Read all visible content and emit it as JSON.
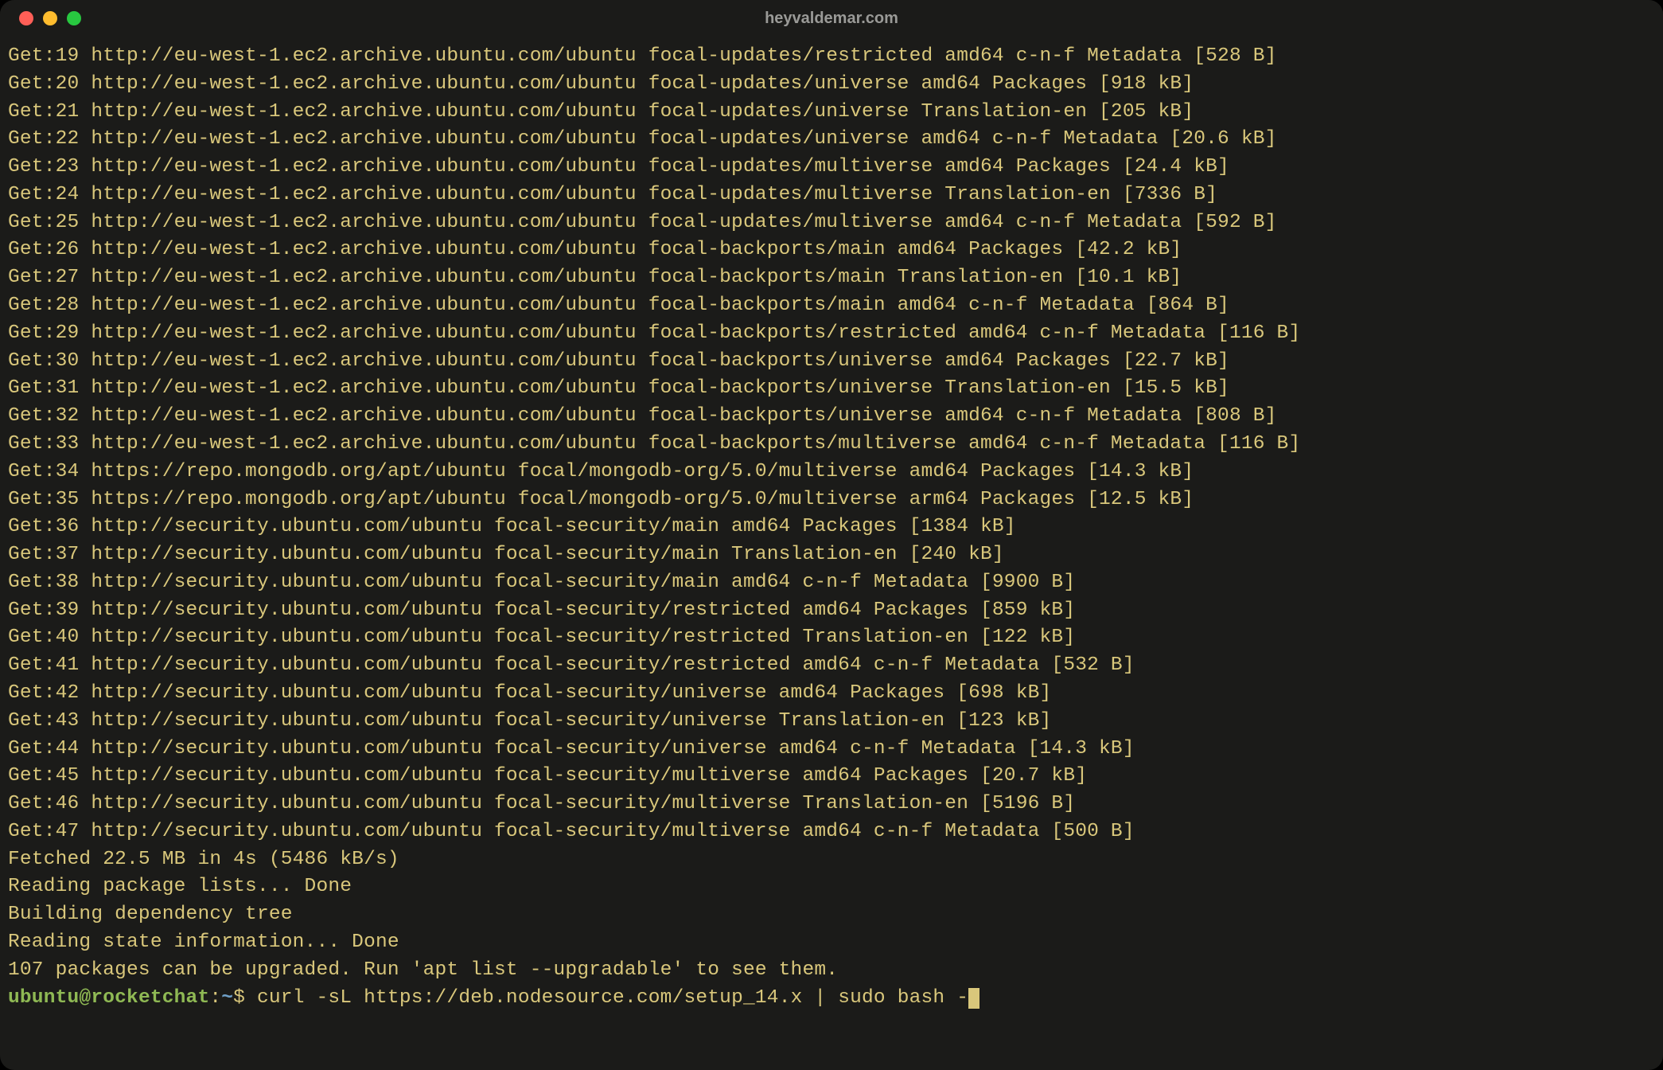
{
  "window": {
    "title": "heyvaldemar.com"
  },
  "output_lines": [
    "Get:19 http://eu-west-1.ec2.archive.ubuntu.com/ubuntu focal-updates/restricted amd64 c-n-f Metadata [528 B]",
    "Get:20 http://eu-west-1.ec2.archive.ubuntu.com/ubuntu focal-updates/universe amd64 Packages [918 kB]",
    "Get:21 http://eu-west-1.ec2.archive.ubuntu.com/ubuntu focal-updates/universe Translation-en [205 kB]",
    "Get:22 http://eu-west-1.ec2.archive.ubuntu.com/ubuntu focal-updates/universe amd64 c-n-f Metadata [20.6 kB]",
    "Get:23 http://eu-west-1.ec2.archive.ubuntu.com/ubuntu focal-updates/multiverse amd64 Packages [24.4 kB]",
    "Get:24 http://eu-west-1.ec2.archive.ubuntu.com/ubuntu focal-updates/multiverse Translation-en [7336 B]",
    "Get:25 http://eu-west-1.ec2.archive.ubuntu.com/ubuntu focal-updates/multiverse amd64 c-n-f Metadata [592 B]",
    "Get:26 http://eu-west-1.ec2.archive.ubuntu.com/ubuntu focal-backports/main amd64 Packages [42.2 kB]",
    "Get:27 http://eu-west-1.ec2.archive.ubuntu.com/ubuntu focal-backports/main Translation-en [10.1 kB]",
    "Get:28 http://eu-west-1.ec2.archive.ubuntu.com/ubuntu focal-backports/main amd64 c-n-f Metadata [864 B]",
    "Get:29 http://eu-west-1.ec2.archive.ubuntu.com/ubuntu focal-backports/restricted amd64 c-n-f Metadata [116 B]",
    "Get:30 http://eu-west-1.ec2.archive.ubuntu.com/ubuntu focal-backports/universe amd64 Packages [22.7 kB]",
    "Get:31 http://eu-west-1.ec2.archive.ubuntu.com/ubuntu focal-backports/universe Translation-en [15.5 kB]",
    "Get:32 http://eu-west-1.ec2.archive.ubuntu.com/ubuntu focal-backports/universe amd64 c-n-f Metadata [808 B]",
    "Get:33 http://eu-west-1.ec2.archive.ubuntu.com/ubuntu focal-backports/multiverse amd64 c-n-f Metadata [116 B]",
    "Get:34 https://repo.mongodb.org/apt/ubuntu focal/mongodb-org/5.0/multiverse amd64 Packages [14.3 kB]",
    "Get:35 https://repo.mongodb.org/apt/ubuntu focal/mongodb-org/5.0/multiverse arm64 Packages [12.5 kB]",
    "Get:36 http://security.ubuntu.com/ubuntu focal-security/main amd64 Packages [1384 kB]",
    "Get:37 http://security.ubuntu.com/ubuntu focal-security/main Translation-en [240 kB]",
    "Get:38 http://security.ubuntu.com/ubuntu focal-security/main amd64 c-n-f Metadata [9900 B]",
    "Get:39 http://security.ubuntu.com/ubuntu focal-security/restricted amd64 Packages [859 kB]",
    "Get:40 http://security.ubuntu.com/ubuntu focal-security/restricted Translation-en [122 kB]",
    "Get:41 http://security.ubuntu.com/ubuntu focal-security/restricted amd64 c-n-f Metadata [532 B]",
    "Get:42 http://security.ubuntu.com/ubuntu focal-security/universe amd64 Packages [698 kB]",
    "Get:43 http://security.ubuntu.com/ubuntu focal-security/universe Translation-en [123 kB]",
    "Get:44 http://security.ubuntu.com/ubuntu focal-security/universe amd64 c-n-f Metadata [14.3 kB]",
    "Get:45 http://security.ubuntu.com/ubuntu focal-security/multiverse amd64 Packages [20.7 kB]",
    "Get:46 http://security.ubuntu.com/ubuntu focal-security/multiverse Translation-en [5196 B]",
    "Get:47 http://security.ubuntu.com/ubuntu focal-security/multiverse amd64 c-n-f Metadata [500 B]",
    "Fetched 22.5 MB in 4s (5486 kB/s)",
    "Reading package lists... Done",
    "Building dependency tree",
    "Reading state information... Done",
    "107 packages can be upgraded. Run 'apt list --upgradable' to see them."
  ],
  "prompt": {
    "user": "ubuntu",
    "at": "@",
    "host": "rocketchat",
    "colon": ":",
    "path": "~",
    "symbol": "$",
    "command": "curl -sL https://deb.nodesource.com/setup_14.x | sudo bash -"
  }
}
